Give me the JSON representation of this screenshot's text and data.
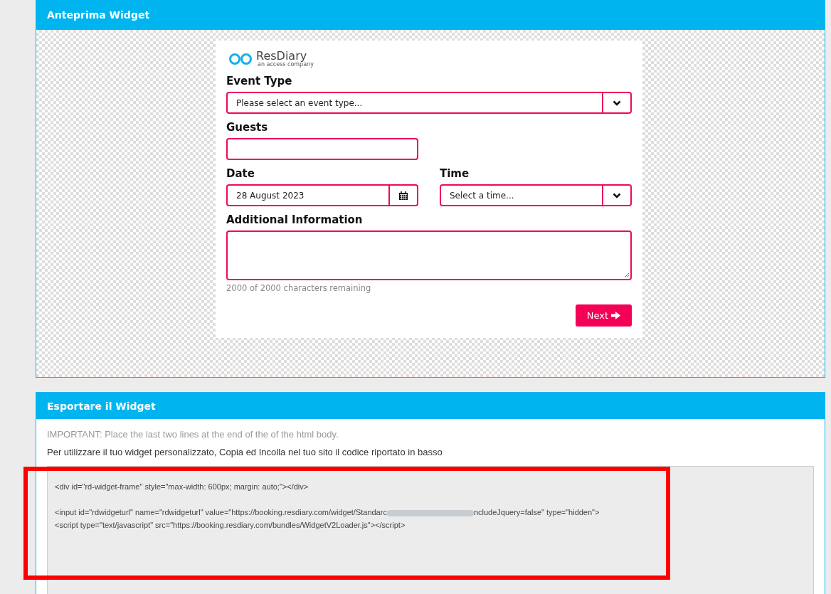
{
  "preview_panel": {
    "title": "Anteprima Widget",
    "widget": {
      "brand": "ResDiary",
      "tagline": "an access company",
      "fields": [
        {
          "kind": "select",
          "label": "Event Type",
          "value": "Please select an event type..."
        },
        {
          "kind": "number",
          "label": "Guests"
        }
      ],
      "row": [
        {
          "kind": "date",
          "label": "Date",
          "value": "28 August 2023"
        },
        {
          "kind": "select",
          "label": "Time",
          "value": "Select a time..."
        }
      ],
      "textarea": {
        "label": "Additional Information",
        "hint": "2000 of 2000 characters remaining"
      },
      "next_button": "Next"
    }
  },
  "export_panel": {
    "title": "Esportare il Widget",
    "notice": "IMPORTANT: Place the last two lines at the end of the of the html body.",
    "instructions": "Per utilizzare il tuo widget personalizzato, Copia ed Incolla nel tuo sito il codice riportato in basso",
    "code": [
      [
        {
          "parts": [
            {
              "kind": "text",
              "text": "<div id=\"rd-widget-frame\" style=\"max-width: 600px; margin: auto;\"></div>"
            }
          ]
        }
      ],
      [
        {
          "parts": [
            {
              "kind": "text",
              "text": "<input id=\"rdwidgeturl\" name=\"rdwidgeturl\" value=\"https://booking.resdiary.com/widget/Standarc"
            },
            {
              "kind": "redacted"
            },
            {
              "kind": "text",
              "text": "ncludeJquery=false\" type=\"hidden\">"
            }
          ]
        },
        {
          "parts": [
            {
              "kind": "text",
              "text": "<script type=\"text/javascript\" src=\"https://booking.resdiary.com/bundles/WidgetV2Loader.js\"></script>"
            }
          ]
        }
      ]
    ]
  }
}
